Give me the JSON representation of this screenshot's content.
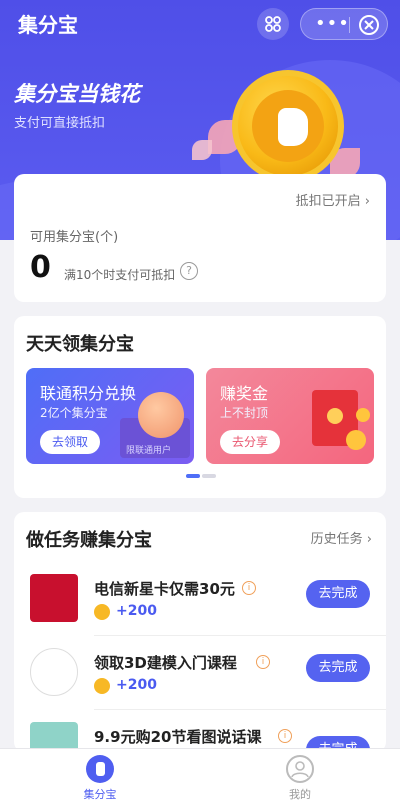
{
  "app": {
    "title": "集分宝"
  },
  "topbar": {
    "scan_icon": "scan-icon",
    "more_label": "•••",
    "close_icon": "close-circle-icon"
  },
  "hero": {
    "slogan": "集分宝当钱花",
    "sub_slogan": "支付可直接抵扣"
  },
  "balance": {
    "deduct_status": "抵扣已开启 ›",
    "available_label": "可用集分宝(个)",
    "amount": "0",
    "hint": "满10个时支付可抵扣",
    "help_icon": "?"
  },
  "earn": {
    "title": "天天领集分宝",
    "promos": [
      {
        "title": "联通积分兑换",
        "subtitle": "2亿个集分宝",
        "button": "去领取",
        "box_text": "限联通用户"
      },
      {
        "title": "赚奖金",
        "subtitle": "上不封顶",
        "button": "去分享"
      }
    ]
  },
  "tasks": {
    "title": "做任务赚集分宝",
    "history_link": "历史任务 ›",
    "items": [
      {
        "title": "电信新星卡仅需30元",
        "reward": "+200",
        "button": "去完成",
        "thumb_color": "#c8102e"
      },
      {
        "title": "领取3D建模入门课程",
        "reward": "+200",
        "button": "去完成",
        "thumb_color": "#ffffff"
      },
      {
        "title": "9.9元购20节看图说话课",
        "reward": "",
        "button": "去完成",
        "thumb_color": "#8fd3c8"
      }
    ]
  },
  "tabbar": {
    "items": [
      {
        "label": "集分宝",
        "icon": "jifenbao-icon",
        "active": true
      },
      {
        "label": "我的",
        "icon": "user-icon",
        "active": false
      }
    ]
  },
  "colors": {
    "primary": "#4f5ef0",
    "hero_bg": "#5557ec",
    "coin": "#f7b825"
  }
}
